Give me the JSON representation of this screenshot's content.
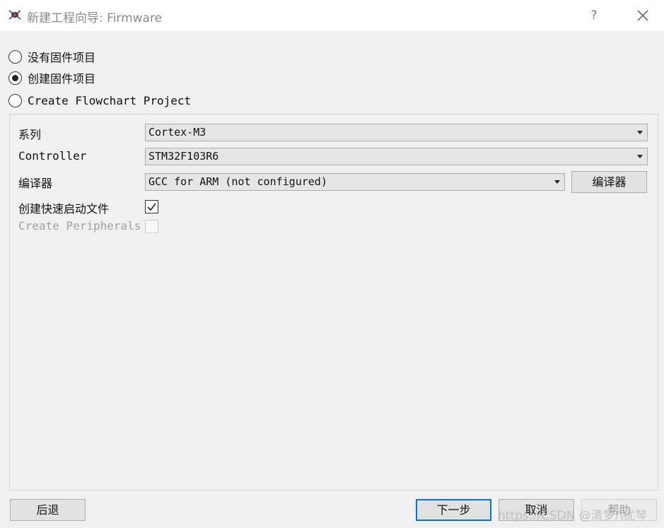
{
  "window": {
    "title": "新建工程向导: Firmware",
    "help_label": "?",
    "icons": {
      "app": "app-logo-icon",
      "close": "close-icon"
    }
  },
  "project_type": {
    "options": [
      {
        "label": "没有固件项目",
        "checked": false
      },
      {
        "label": "创建固件项目",
        "checked": true
      },
      {
        "label": "Create Flowchart Project",
        "checked": false
      }
    ]
  },
  "form": {
    "family": {
      "label": "系列",
      "value": "Cortex-M3"
    },
    "controller": {
      "label": "Controller",
      "value": "STM32F103R6"
    },
    "compiler": {
      "label": "编译器",
      "value": "GCC for ARM (not configured)",
      "button_label": "编译器"
    },
    "quick_start": {
      "label": "创建快速启动文件",
      "checked": true
    },
    "peripherals": {
      "label": "Create Peripherals",
      "checked": false,
      "disabled": true
    }
  },
  "footer": {
    "back_label": "后退",
    "next_label": "下一步",
    "cancel_label": "取消",
    "help_label": "帮助"
  },
  "watermark": "https://CSDN @清梦/\\扰琴",
  "colors": {
    "accent": "#0078d7",
    "panel_bg": "#f0f0f0",
    "disabled_text": "#a0a0a0"
  }
}
